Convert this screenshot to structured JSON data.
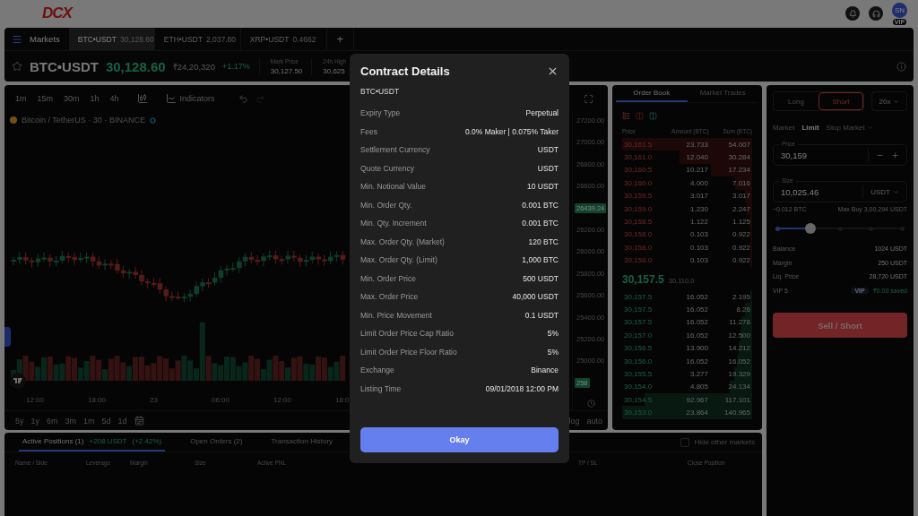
{
  "header": {
    "logo": "DCX",
    "avatar": "SN",
    "avatar_badge": "VIP"
  },
  "market_tabs": {
    "label": "Markets",
    "tabs": [
      {
        "pair": "BTC•USDT",
        "price": "30,128.60",
        "selected": true
      },
      {
        "pair": "ETH•USDT",
        "price": "2,037.80",
        "selected": false
      },
      {
        "pair": "XRP•USDT",
        "price": "0.4662",
        "selected": false
      }
    ],
    "add": "+"
  },
  "ticker": {
    "pair": "BTC•USDT",
    "price": "30,128.60",
    "inr": "₹24,20,320",
    "change": "+1.17%",
    "stats": [
      {
        "label": "Mark Price",
        "value": "30,127.50"
      },
      {
        "label": "24h High",
        "value": "30,625"
      }
    ]
  },
  "chart": {
    "intervals": [
      "1m",
      "15m",
      "30m",
      "1h",
      "4h"
    ],
    "indicators": "Indicators",
    "legend": "Bitcoin / TetherUS · 30 · BINANCE",
    "price_axis": [
      {
        "kind": "tick",
        "label": "27200.00"
      },
      {
        "kind": "tick",
        "label": "27000.00"
      },
      {
        "kind": "tick",
        "label": "26800.00"
      },
      {
        "kind": "tick",
        "label": "26600.00"
      },
      {
        "kind": "tag",
        "label": "26439.24"
      },
      {
        "kind": "tick",
        "label": "26200.00"
      },
      {
        "kind": "tick",
        "label": "26000.00"
      },
      {
        "kind": "tick",
        "label": "25800.00"
      },
      {
        "kind": "tick",
        "label": "25600.00"
      },
      {
        "kind": "tick",
        "label": "25400.00"
      },
      {
        "kind": "tick",
        "label": "25200.00"
      },
      {
        "kind": "tick",
        "label": "25000.00"
      },
      {
        "kind": "tag",
        "label": "258"
      }
    ],
    "time_axis": [
      "12:00",
      "18:00",
      "23",
      "06:00",
      "12:00",
      "18:0"
    ],
    "ranges": [
      "5y",
      "1y",
      "6m",
      "3m",
      "1m",
      "5d",
      "1d"
    ],
    "scale_options": [
      "log",
      "auto"
    ]
  },
  "order_book": {
    "tabs": [
      {
        "label": "Order Book",
        "selected": true
      },
      {
        "label": "Market Trades",
        "selected": false
      }
    ],
    "columns": [
      "Price",
      "Amount (BTC)",
      "Sum (BTC)"
    ],
    "asks": [
      {
        "price": "30,161.5",
        "amount": "23.733",
        "sum": "54.007"
      },
      {
        "price": "30,161.0",
        "amount": "12.040",
        "sum": "30.284"
      },
      {
        "price": "30,160.5",
        "amount": "10.217",
        "sum": "17.234"
      },
      {
        "price": "30,160.0",
        "amount": "4.000",
        "sum": "7.016"
      },
      {
        "price": "30,159.5",
        "amount": "3.017",
        "sum": "3.017"
      },
      {
        "price": "30,159.0",
        "amount": "1.230",
        "sum": "2.247"
      },
      {
        "price": "30,158.5",
        "amount": "1.122",
        "sum": "1.125"
      },
      {
        "price": "30,158.0",
        "amount": "0.103",
        "sum": "0.922"
      },
      {
        "price": "30,158.0",
        "amount": "0.103",
        "sum": "0.922"
      },
      {
        "price": "30,158.0",
        "amount": "0.103",
        "sum": "0.922"
      }
    ],
    "last_price": "30,157.5",
    "index_price": "30,110.0",
    "bids": [
      {
        "price": "30,157.5",
        "amount": "16.052",
        "sum": "2.195"
      },
      {
        "price": "30,157.5",
        "amount": "16.052",
        "sum": "8.26"
      },
      {
        "price": "30,157.5",
        "amount": "16.052",
        "sum": "11.278"
      },
      {
        "price": "20,157.0",
        "amount": "16.052",
        "sum": "12.500"
      },
      {
        "price": "30,156.5",
        "amount": "13.900",
        "sum": "14.212"
      },
      {
        "price": "30,156.0",
        "amount": "16.052",
        "sum": "16.052"
      },
      {
        "price": "30,155.5",
        "amount": "3.277",
        "sum": "19.329"
      },
      {
        "price": "30,154.0",
        "amount": "4.805",
        "sum": "24.134"
      },
      {
        "price": "30,154.5",
        "amount": "92.967",
        "sum": "117.101"
      },
      {
        "price": "30,153.0",
        "amount": "23.864",
        "sum": "140.965"
      }
    ]
  },
  "order_form": {
    "sides": [
      {
        "label": "Long",
        "selected": false
      },
      {
        "label": "Short",
        "selected": true
      }
    ],
    "leverage": "20x",
    "order_types": [
      {
        "label": "Market",
        "selected": false,
        "menu": false
      },
      {
        "label": "Limit",
        "selected": true,
        "menu": false
      },
      {
        "label": "Stop Market",
        "selected": false,
        "menu": true
      }
    ],
    "price_field": {
      "label": "Price",
      "value": "30,159"
    },
    "size_field": {
      "label": "Size",
      "value": "10,025.46",
      "unit": "USDT"
    },
    "size_hint": "~0.012 BTC",
    "max_buy": "Max Buy 3,00,294 USDT",
    "slider": {
      "level": 0.27
    },
    "summary": [
      {
        "label": "Balance",
        "value": "1024 USDT"
      },
      {
        "label": "Margin",
        "value": "250 USDT"
      },
      {
        "label": "Liq. Price",
        "value": "28,720 USDT"
      }
    ],
    "vip": {
      "label": "VIP 5",
      "badge": "VIP",
      "saved": "₹0.00 saved"
    },
    "submit": "Sell / Short"
  },
  "positions": {
    "tabs": [
      {
        "label": "Active Positions (1)",
        "pnl": "+208 USDT",
        "pnl_pct": "(+2.42%)",
        "selected": true
      },
      {
        "label": "Open Orders (2)",
        "selected": false
      },
      {
        "label": "Transaction History",
        "selected": false
      }
    ],
    "hide_other": {
      "label": "Hide other markets",
      "checked": false
    },
    "columns": [
      "Name / Side",
      "Leverage",
      "Margin",
      "Size",
      "Active PNL",
      "TP / SL",
      "Close Position"
    ]
  },
  "modal": {
    "title": "Contract Details",
    "subtitle": "BTC•USDT",
    "rows": [
      {
        "label": "Expiry Type",
        "value": "Perpetual"
      },
      {
        "label": "Fees",
        "value": "0.0% Maker | 0.075% Taker"
      },
      {
        "label": "Settlement Currency",
        "value": "USDT"
      },
      {
        "label": "Quote Currency",
        "value": "USDT"
      },
      {
        "label": "Min. Notional Value",
        "value": "10 USDT"
      },
      {
        "label": "Min. Order Qty.",
        "value": "0.001 BTC"
      },
      {
        "label": "Min. Qty. Increment",
        "value": "0.001 BTC"
      },
      {
        "label": "Max. Order Qty. (Market)",
        "value": "120 BTC"
      },
      {
        "label": "Max. Order Qty. (Limit)",
        "value": "1,000 BTC"
      },
      {
        "label": "Min. Order Price",
        "value": "500 USDT"
      },
      {
        "label": "Max. Order Price",
        "value": "40,000 USDT"
      },
      {
        "label": "Min. Price Movement",
        "value": "0.1 USDT"
      },
      {
        "label": "Limit Order Price Cap Ratio",
        "value": "5%"
      },
      {
        "label": "Limit Order Price Floor Ratio",
        "value": "5%"
      },
      {
        "label": "Exchange",
        "value": "Binance"
      },
      {
        "label": "Listing Time",
        "value": "09/01/2018 12:00 PM"
      }
    ],
    "button": "Okay"
  }
}
